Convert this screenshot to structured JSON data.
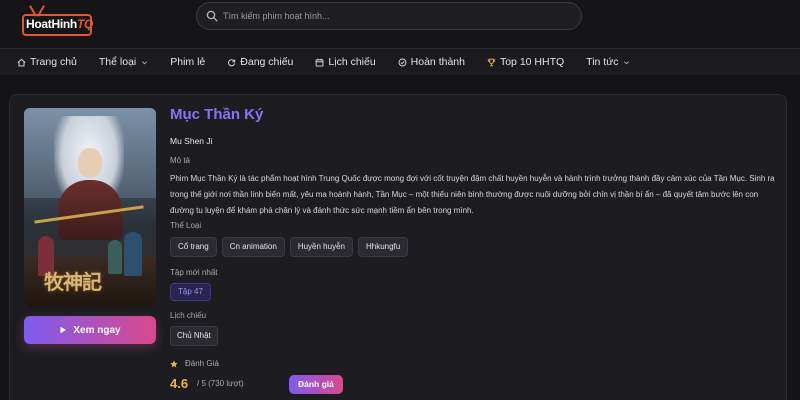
{
  "header": {
    "logo_text": "HoatHinh",
    "logo_suffix": "TQ",
    "search_placeholder": "Tìm kiếm phim hoạt hình..."
  },
  "nav": {
    "items": [
      {
        "label": "Trang chủ",
        "icon": "home-icon"
      },
      {
        "label": "Thể loại",
        "icon": null,
        "dropdown": true
      },
      {
        "label": "Phim lẻ",
        "icon": null
      },
      {
        "label": "Đang chiếu",
        "icon": "refresh-icon"
      },
      {
        "label": "Lịch chiếu",
        "icon": "calendar-icon"
      },
      {
        "label": "Hoàn thành",
        "icon": "check-circle-icon"
      },
      {
        "label": "Top 10 HHTQ",
        "icon": "trophy-icon"
      },
      {
        "label": "Tin tức",
        "icon": null,
        "dropdown": true
      }
    ]
  },
  "poster": {
    "title_text": "牧神記"
  },
  "actions": {
    "watch_label": "Xem ngay",
    "rate_label": "Đánh giá"
  },
  "detail": {
    "title": "Mục Thần Ký",
    "original_title": "Mu Shen Ji",
    "description_label": "Mô tả",
    "description": "Phim Mục Thần Ký là tác phẩm hoạt hình Trung Quốc được mong đợi với cốt truyện đậm chất huyền huyễn và hành trình trưởng thành đầy cảm xúc của Tần Mục. Sinh ra trong thế giới nơi thần linh biến mất, yêu ma hoành hành, Tần Mục – một thiếu niên bình thường được nuôi dưỡng bởi chín vị thần bí ẩn – đã quyết tâm bước lên con đường tu luyện để khám phá chân lý và đánh thức sức mạnh tiềm ẩn bên trong mình.",
    "genre_label": "Thể Loại",
    "genres": [
      "Cổ trang",
      "Cn animation",
      "Huyền huyễn",
      "Hhkungfu"
    ],
    "latest_label": "Tập mới nhất",
    "latest_episode": "Tập 47",
    "schedule_label": "Lịch chiếu",
    "schedule_day": "Chủ Nhật",
    "rating_label": "Đánh Giá",
    "rating_score": "4.6",
    "rating_of": "/ 5 (730 lượt)"
  },
  "colors": {
    "accent_purple": "#8b72f2",
    "accent_pink": "#d9488c",
    "star_yellow": "#f2b83a",
    "logo_orange": "#e8542e"
  }
}
